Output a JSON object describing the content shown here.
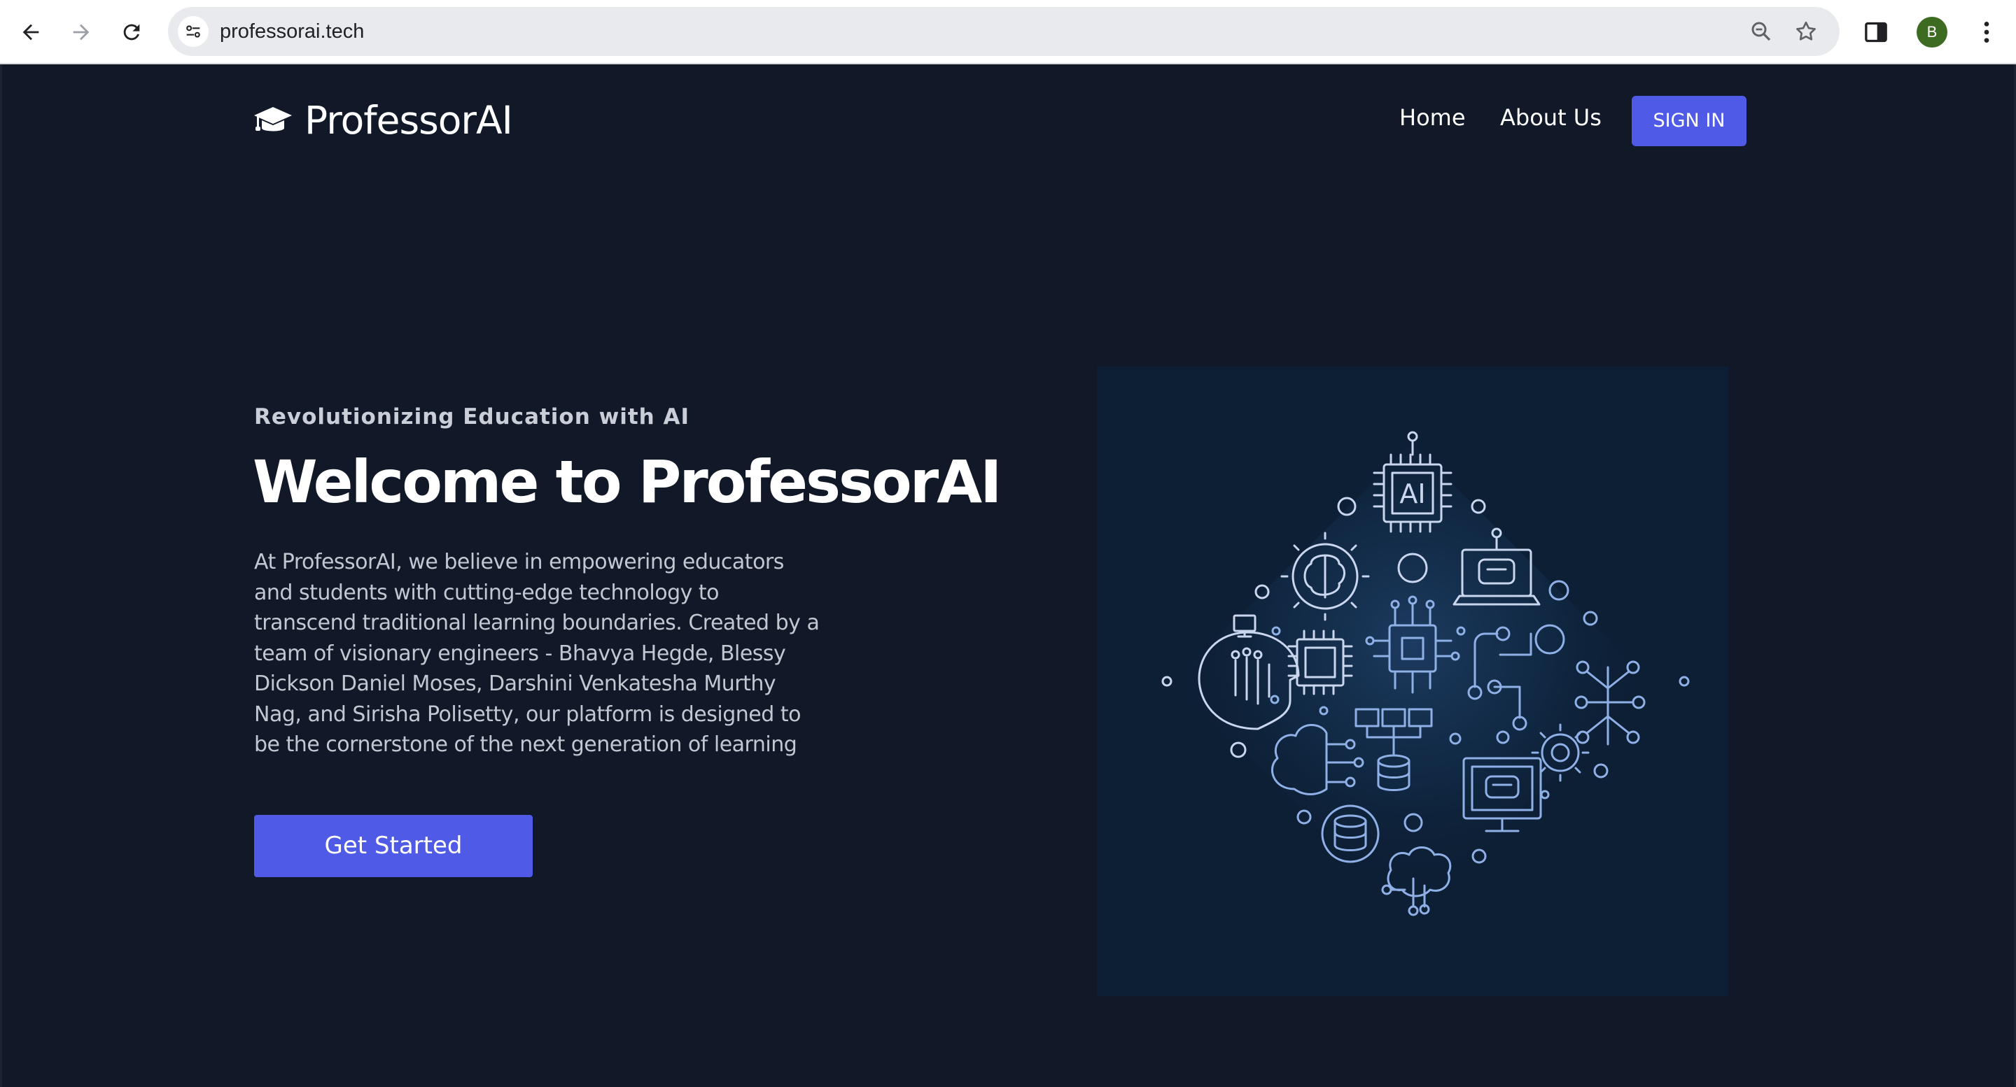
{
  "browser": {
    "url": "professorai.tech",
    "profile_initial": "B"
  },
  "nav": {
    "brand": "ProfessorAI",
    "links": [
      {
        "label": "Home"
      },
      {
        "label": "About Us"
      }
    ],
    "signin_label": "SIGN IN"
  },
  "hero": {
    "tagline": "Revolutionizing Education with AI",
    "title": "Welcome to ProfessorAI",
    "description": "At ProfessorAI, we believe in empowering educators and students with cutting-edge technology to transcend traditional learning boundaries. Created by a team of visionary engineers - Bhavya Hegde, Blessy Dickson Daniel Moses, Darshini Venkatesha Murthy Nag, and Sirisha Polisetty, our platform is designed to be the cornerstone of the next generation of learning",
    "cta_label": "Get Started",
    "illustration_badge": "AI"
  },
  "colors": {
    "page_background": "#111827",
    "accent": "#4f5ae6",
    "illustration_background": "#0d1f35"
  },
  "icons": [
    "back-arrow-icon",
    "forward-arrow-icon",
    "reload-icon",
    "site-info-icon",
    "zoom-icon",
    "bookmark-star-icon",
    "side-panel-icon",
    "kebab-menu-icon",
    "graduation-cap-icon"
  ]
}
